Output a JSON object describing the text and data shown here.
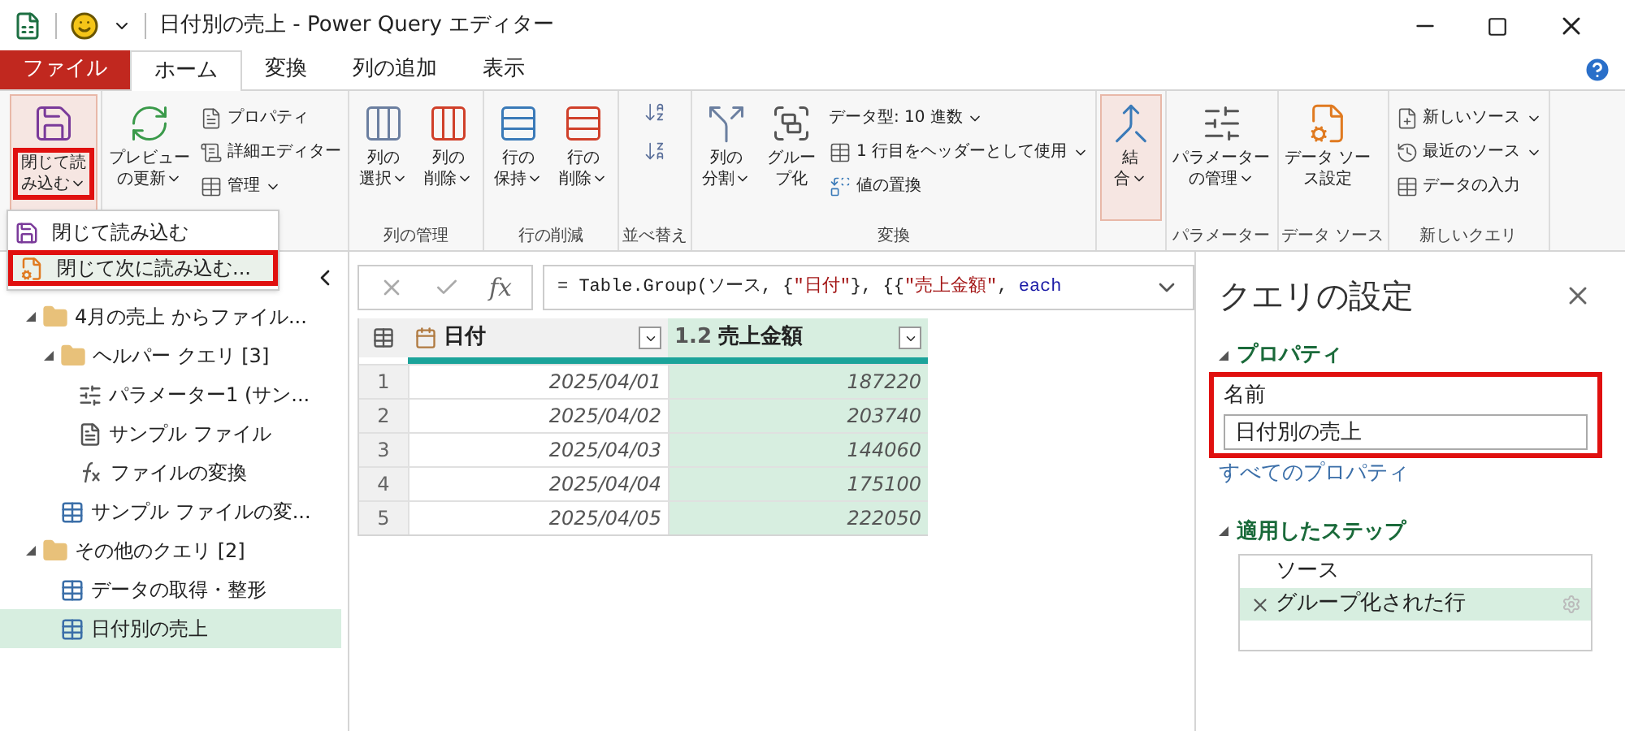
{
  "window": {
    "title": "日付別の売上 - Power Query エディター"
  },
  "tabs": [
    {
      "label": "ファイル",
      "kind": "file",
      "selected": false
    },
    {
      "label": "ホーム",
      "kind": "tab",
      "selected": true
    },
    {
      "label": "変換",
      "kind": "tab",
      "selected": false
    },
    {
      "label": "列の追加",
      "kind": "tab",
      "selected": false
    },
    {
      "label": "表示",
      "kind": "tab",
      "selected": false
    }
  ],
  "ribbon": [
    {
      "buttons": [
        {
          "kind": "large",
          "lines": [
            "閉じて読",
            "み込む"
          ],
          "dropdown": true,
          "highlighted": true,
          "hovered": true
        }
      ]
    },
    {
      "buttons": [
        {
          "kind": "large",
          "lines": [
            "プレビュー",
            "の更新"
          ],
          "dropdown": true,
          "highlighted": false,
          "hovered": false
        },
        {
          "kind": "small",
          "label": "プロパティ",
          "dropdown": false
        },
        {
          "kind": "small",
          "label": "詳細エディター",
          "dropdown": false
        },
        {
          "kind": "small",
          "label": "管理",
          "dropdown": true
        }
      ]
    },
    {
      "label": "列の管理",
      "buttons": [
        {
          "kind": "large",
          "lines": [
            "列の",
            "選択"
          ],
          "dropdown": true,
          "highlighted": false,
          "hovered": false
        },
        {
          "kind": "large",
          "lines": [
            "列の",
            "削除"
          ],
          "dropdown": true,
          "highlighted": false,
          "hovered": false
        }
      ]
    },
    {
      "label": "行の削減",
      "buttons": [
        {
          "kind": "large",
          "lines": [
            "行の",
            "保持"
          ],
          "dropdown": true,
          "highlighted": false,
          "hovered": false
        },
        {
          "kind": "large",
          "lines": [
            "行の",
            "削除"
          ],
          "dropdown": true,
          "highlighted": false,
          "hovered": false
        }
      ]
    },
    {
      "label": "並べ替え",
      "buttons": [
        {
          "kind": "icon"
        },
        {
          "kind": "icon"
        }
      ]
    },
    {
      "label": "変換",
      "buttons": [
        {
          "kind": "large",
          "lines": [
            "列の",
            "分割"
          ],
          "dropdown": true,
          "highlighted": false,
          "hovered": false
        },
        {
          "kind": "large",
          "lines": [
            "グルー",
            "プ化"
          ],
          "dropdown": false,
          "highlighted": false,
          "hovered": false
        },
        {
          "kind": "small",
          "label": "データ型: 10 進数",
          "dropdown": true
        },
        {
          "kind": "small",
          "label": "1 行目をヘッダーとして使用",
          "dropdown": true
        },
        {
          "kind": "small",
          "label": "値の置換",
          "dropdown": false
        }
      ]
    },
    {
      "buttons": [
        {
          "kind": "large",
          "lines": [
            "結",
            "合"
          ],
          "dropdown": true,
          "highlighted": false,
          "hovered": true
        }
      ]
    },
    {
      "label": "パラメーター",
      "buttons": [
        {
          "kind": "large",
          "lines": [
            "パラメーター",
            "の管理"
          ],
          "dropdown": true,
          "highlighted": false,
          "hovered": false
        }
      ]
    },
    {
      "label": "データ ソース",
      "buttons": [
        {
          "kind": "large",
          "lines": [
            "データ ソー",
            "ス設定"
          ],
          "dropdown": false,
          "highlighted": false,
          "hovered": false
        }
      ]
    },
    {
      "label": "新しいクエリ",
      "buttons": [
        {
          "kind": "small",
          "label": "新しいソース",
          "dropdown": true
        },
        {
          "kind": "small",
          "label": "最近のソース",
          "dropdown": true
        },
        {
          "kind": "small",
          "label": "データの入力",
          "dropdown": false
        }
      ]
    }
  ],
  "menu": [
    {
      "label": "閉じて読み込む",
      "highlighted": false
    },
    {
      "label": "閉じて次に読み込む...",
      "highlighted": true
    }
  ],
  "queries": [
    {
      "kind": "folder",
      "label": "4月の売上 からファイル...",
      "expanded": true,
      "selected": false,
      "children": [
        {
          "kind": "folder",
          "label": "ヘルパー クエリ [3]",
          "expanded": true,
          "selected": false,
          "children": [
            {
              "kind": "parameter",
              "label": "パラメーター1 (サン...",
              "selected": false
            },
            {
              "kind": "file",
              "label": "サンプル ファイル",
              "selected": false
            },
            {
              "kind": "function",
              "label": "ファイルの変換",
              "selected": false
            }
          ]
        },
        {
          "kind": "table",
          "label": "サンプル ファイルの変...",
          "selected": false
        }
      ]
    },
    {
      "kind": "folder",
      "label": "その他のクエリ [2]",
      "expanded": true,
      "selected": false,
      "children": [
        {
          "kind": "table",
          "label": "データの取得・整形",
          "selected": false
        },
        {
          "kind": "table",
          "label": "日付別の売上",
          "selected": true
        }
      ]
    }
  ],
  "formula_bar": {
    "function_label": "fx",
    "formula": [
      {
        "text": "= Table.Group(ソース, {",
        "kind": "code"
      },
      {
        "text": "\"日付\"",
        "kind": "string"
      },
      {
        "text": "}, {{",
        "kind": "code"
      },
      {
        "text": "\"売上金額\"",
        "kind": "string"
      },
      {
        "text": ", ",
        "kind": "code"
      },
      {
        "text": "each",
        "kind": "keyword"
      }
    ]
  },
  "table": {
    "columns": [
      {
        "label": "日付",
        "kind": "date",
        "selected": false
      },
      {
        "label": "売上金額",
        "kind": "decimal",
        "type_label": "1.2",
        "selected": true
      }
    ],
    "rows": [
      {
        "number": "1",
        "cells": [
          "2025/04/01",
          "187220"
        ]
      },
      {
        "number": "2",
        "cells": [
          "2025/04/02",
          "203740"
        ]
      },
      {
        "number": "3",
        "cells": [
          "2025/04/03",
          "144060"
        ]
      },
      {
        "number": "4",
        "cells": [
          "2025/04/04",
          "175100"
        ]
      },
      {
        "number": "5",
        "cells": [
          "2025/04/05",
          "222050"
        ]
      }
    ]
  },
  "settings": {
    "title": "クエリの設定",
    "properties_heading": "プロパティ",
    "name_label": "名前",
    "name_value": "日付別の売上",
    "name_highlighted": true,
    "all_properties_link": "すべてのプロパティ",
    "steps_heading": "適用したステップ",
    "steps": [
      {
        "label": "ソース",
        "selected": false
      },
      {
        "label": "グループ化された行",
        "selected": true
      }
    ]
  }
}
